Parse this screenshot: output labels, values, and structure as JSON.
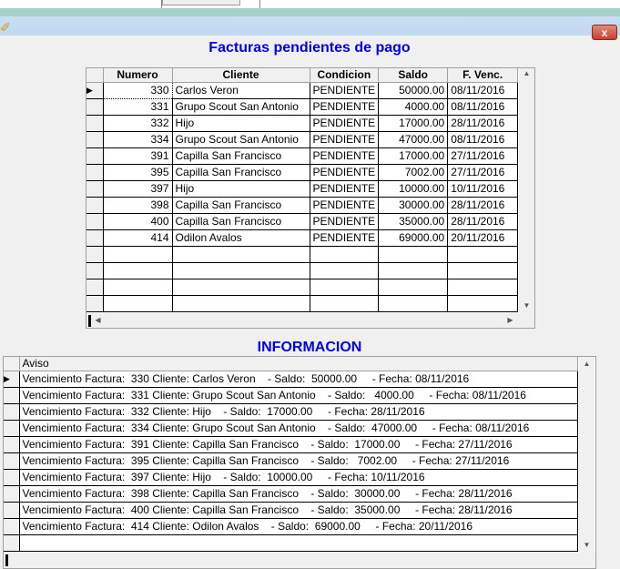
{
  "window": {
    "close_glyph": "x"
  },
  "facturas": {
    "title": "Facturas pendientes de pago",
    "columns": [
      "Numero",
      "Cliente",
      "Condicion",
      "Saldo",
      "F. Venc."
    ],
    "rows": [
      [
        "330",
        "Carlos Veron",
        "PENDIENTE",
        "50000.00",
        "08/11/2016"
      ],
      [
        "331",
        "Grupo Scout San Antonio",
        "PENDIENTE",
        "4000.00",
        "08/11/2016"
      ],
      [
        "332",
        "Hijo",
        "PENDIENTE",
        "17000.00",
        "28/11/2016"
      ],
      [
        "334",
        "Grupo Scout San Antonio",
        "PENDIENTE",
        "47000.00",
        "08/11/2016"
      ],
      [
        "391",
        "Capilla San Francisco",
        "PENDIENTE",
        "17000.00",
        "27/11/2016"
      ],
      [
        "395",
        "Capilla San Francisco",
        "PENDIENTE",
        "7002.00",
        "27/11/2016"
      ],
      [
        "397",
        "Hijo",
        "PENDIENTE",
        "10000.00",
        "10/11/2016"
      ],
      [
        "398",
        "Capilla San Francisco",
        "PENDIENTE",
        "30000.00",
        "28/11/2016"
      ],
      [
        "400",
        "Capilla San Francisco",
        "PENDIENTE",
        "35000.00",
        "28/11/2016"
      ],
      [
        "414",
        "Odilon Avalos",
        "PENDIENTE",
        "69000.00",
        "20/11/2016"
      ]
    ]
  },
  "informacion": {
    "title": "INFORMACION",
    "column": "Aviso",
    "rows": [
      "Vencimiento Factura:  330 Cliente: Carlos Veron    - Saldo:  50000.00     - Fecha: 08/11/2016",
      "Vencimiento Factura:  331 Cliente: Grupo Scout San Antonio    - Saldo:   4000.00     - Fecha: 08/11/2016",
      "Vencimiento Factura:  332 Cliente: Hijo    - Saldo:  17000.00     - Fecha: 28/11/2016",
      "Vencimiento Factura:  334 Cliente: Grupo Scout San Antonio    - Saldo:  47000.00     - Fecha: 08/11/2016",
      "Vencimiento Factura:  391 Cliente: Capilla San Francisco    - Saldo:  17000.00     - Fecha: 27/11/2016",
      "Vencimiento Factura:  395 Cliente: Capilla San Francisco    - Saldo:   7002.00     - Fecha: 27/11/2016",
      "Vencimiento Factura:  397 Cliente: Hijo    - Saldo:  10000.00     - Fecha: 10/11/2016",
      "Vencimiento Factura:  398 Cliente: Capilla San Francisco    - Saldo:  30000.00     - Fecha: 28/11/2016",
      "Vencimiento Factura:  400 Cliente: Capilla San Francisco    - Saldo:  35000.00     - Fecha: 28/11/2016",
      "Vencimiento Factura:  414 Cliente: Odilon Avalos    - Saldo:  69000.00     - Fecha: 20/11/2016"
    ]
  },
  "colors": {
    "heading": "#0000ee",
    "titlebar": "#c0d8f1",
    "close": "#c7402c"
  },
  "icons": {
    "app": "pencil-icon",
    "row_pointer": "triangle-right-icon"
  }
}
